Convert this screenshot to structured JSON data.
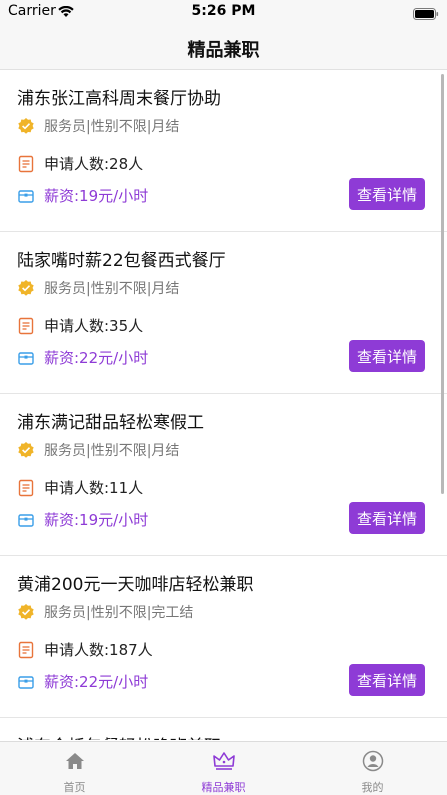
{
  "status": {
    "carrier": "Carrier",
    "time": "5:26 PM"
  },
  "nav": {
    "title": "精品兼职"
  },
  "jobs": [
    {
      "title": "浦东张江高科周末餐厅协助",
      "tags": "服务员|性别不限|月结",
      "applicants": "申请人数:28人",
      "salary": "薪资:19元/小时",
      "button": "查看详情"
    },
    {
      "title": "陆家嘴时薪22包餐西式餐厅",
      "tags": "服务员|性别不限|月结",
      "applicants": "申请人数:35人",
      "salary": "薪资:22元/小时",
      "button": "查看详情"
    },
    {
      "title": "浦东满记甜品轻松寒假工",
      "tags": "服务员|性别不限|月结",
      "applicants": "申请人数:11人",
      "salary": "薪资:19元/小时",
      "button": "查看详情"
    },
    {
      "title": "黄浦200元一天咖啡店轻松兼职",
      "tags": "服务员|性别不限|完工结",
      "applicants": "申请人数:187人",
      "salary": "薪资:22元/小时",
      "button": "查看详情"
    },
    {
      "title": "浦东金桥包餐轻松晚班兼职"
    }
  ],
  "tabs": [
    {
      "label": "首页",
      "icon": "home-icon"
    },
    {
      "label": "精品兼职",
      "icon": "crown-icon"
    },
    {
      "label": "我的",
      "icon": "profile-icon"
    }
  ],
  "colors": {
    "accent": "#8e3bd6",
    "badge": "#f0b429",
    "doc_icon": "#e8743b",
    "wallet_icon": "#3a9ee8"
  }
}
